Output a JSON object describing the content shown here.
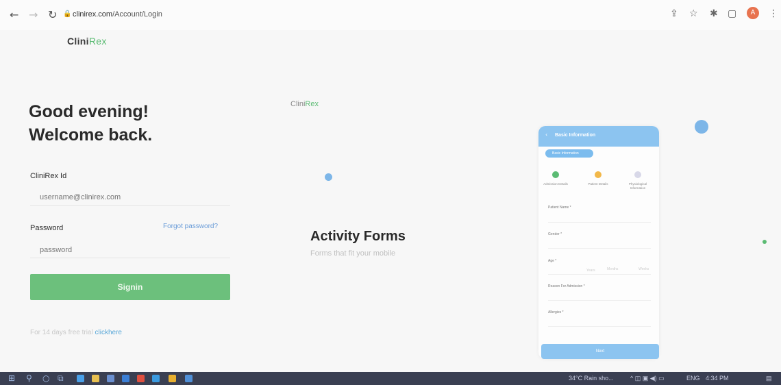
{
  "browser": {
    "url_host": "clinirex.com",
    "url_path": "/Account/Login",
    "avatar_letter": "A"
  },
  "brand": {
    "name_main": "Clini",
    "name_accent": "Rex"
  },
  "login": {
    "greeting_line1": "Good evening!",
    "greeting_line2": "Welcome back.",
    "id_label": "CliniRex Id",
    "id_placeholder": "username@clinirex.com",
    "password_label": "Password",
    "forgot_label": "Forgot password?",
    "password_placeholder": "password",
    "signin_label": "Signin",
    "trial_text": "For 14 days free trial",
    "trial_link": "clickhere"
  },
  "promo": {
    "title": "Activity Forms",
    "subtitle": "Forms that fit your mobile"
  },
  "phone": {
    "header_title": "Basic Information",
    "active_tab": "Basic Information",
    "steps": [
      "Admission Details",
      "Patient Details",
      "Physiological Information"
    ],
    "fields": [
      "Patient Name *",
      "Gender *",
      "Age *",
      "Reason For Admission *",
      "Allergies *"
    ],
    "age_units": [
      "Years",
      "Months",
      "Weeks"
    ],
    "submit_label": "Next"
  },
  "taskbar": {
    "weather": "34°C  Rain sho...",
    "language": "ENG",
    "time": "4:34 PM"
  },
  "colors": {
    "accent_green": "#6cc07c",
    "link_blue": "#6a9cd8",
    "phone_blue": "#8cc4f0"
  }
}
